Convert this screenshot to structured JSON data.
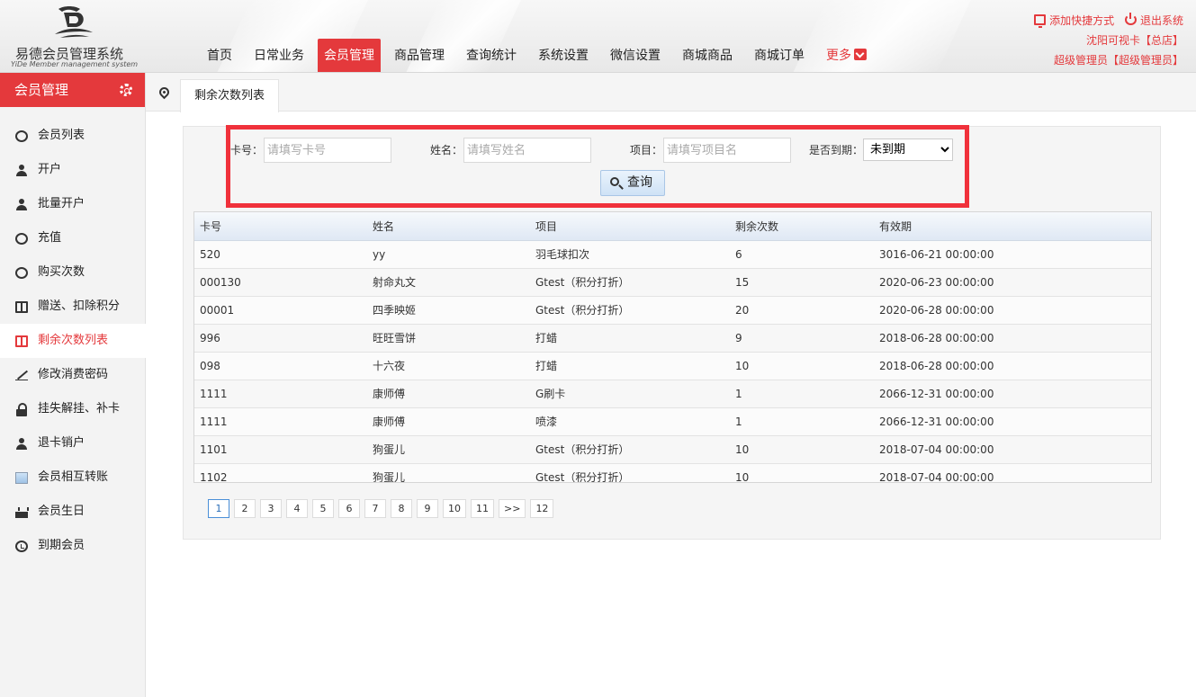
{
  "app": {
    "title": "易德会员管理系统",
    "subtitle": "YiDe Member management system"
  },
  "nav": {
    "items": [
      "首页",
      "日常业务",
      "会员管理",
      "商品管理",
      "查询统计",
      "系统设置",
      "微信设置",
      "商城商品",
      "商城订单"
    ],
    "active": "会员管理",
    "more_label": "更多"
  },
  "top_right": {
    "shortcut_label": "添加快捷方式",
    "logout_label": "退出系统",
    "store": "沈阳可视卡【总店】",
    "user": "超级管理员【超级管理员】"
  },
  "sidebar": {
    "title": "会员管理",
    "items": [
      {
        "label": "会员列表",
        "icon": "user-circle-icon"
      },
      {
        "label": "开户",
        "icon": "user-icon"
      },
      {
        "label": "批量开户",
        "icon": "user-icon"
      },
      {
        "label": "充值",
        "icon": "dollar-circle-icon"
      },
      {
        "label": "购买次数",
        "icon": "paypal-icon"
      },
      {
        "label": "赠送、扣除积分",
        "icon": "book-icon"
      },
      {
        "label": "剩余次数列表",
        "icon": "book-icon"
      },
      {
        "label": "修改消费密码",
        "icon": "pencil-icon"
      },
      {
        "label": "挂失解挂、补卡",
        "icon": "lock-icon"
      },
      {
        "label": "退卡销户",
        "icon": "user-icon"
      },
      {
        "label": "会员相互转账",
        "icon": "image-icon"
      },
      {
        "label": "会员生日",
        "icon": "cake-icon"
      },
      {
        "label": "到期会员",
        "icon": "alarm-clock-icon"
      }
    ],
    "active_index": 6
  },
  "tab": {
    "label": "剩余次数列表"
  },
  "search": {
    "card_label": "卡号：",
    "card_placeholder": "请填写卡号",
    "name_label": "姓名：",
    "name_placeholder": "请填写姓名",
    "item_label": "项目：",
    "item_placeholder": "请填写项目名",
    "expired_label": "是否到期：",
    "expired_value": "未到期",
    "query_label": "查询"
  },
  "table": {
    "columns": [
      "卡号",
      "姓名",
      "项目",
      "剩余次数",
      "有效期"
    ],
    "rows": [
      [
        "520",
        "yy",
        "羽毛球扣次",
        "6",
        "3016-06-21 00:00:00"
      ],
      [
        "000130",
        "射命丸文",
        "Gtest（积分打折）",
        "15",
        "2020-06-23 00:00:00"
      ],
      [
        "00001",
        "四季映姬",
        "Gtest（积分打折）",
        "20",
        "2020-06-28 00:00:00"
      ],
      [
        "996",
        "旺旺雪饼",
        "打蜡",
        "9",
        "2018-06-28 00:00:00"
      ],
      [
        "098",
        "十六夜",
        "打蜡",
        "10",
        "2018-06-28 00:00:00"
      ],
      [
        "1111",
        "康师傅",
        "G刷卡",
        "1",
        "2066-12-31 00:00:00"
      ],
      [
        "1111",
        "康师傅",
        "喷漆",
        "1",
        "2066-12-31 00:00:00"
      ],
      [
        "1101",
        "狗蛋儿",
        "Gtest（积分打折）",
        "10",
        "2018-07-04 00:00:00"
      ],
      [
        "1102",
        "狗蛋儿",
        "Gtest（积分打折）",
        "10",
        "2018-07-04 00:00:00"
      ]
    ]
  },
  "pager": {
    "pages": [
      "1",
      "2",
      "3",
      "4",
      "5",
      "6",
      "7",
      "8",
      "9",
      "10",
      "11",
      ">>",
      "12"
    ],
    "current": "1"
  },
  "colors": {
    "accent": "#e4393c",
    "highlight_box": "#f0313b"
  }
}
